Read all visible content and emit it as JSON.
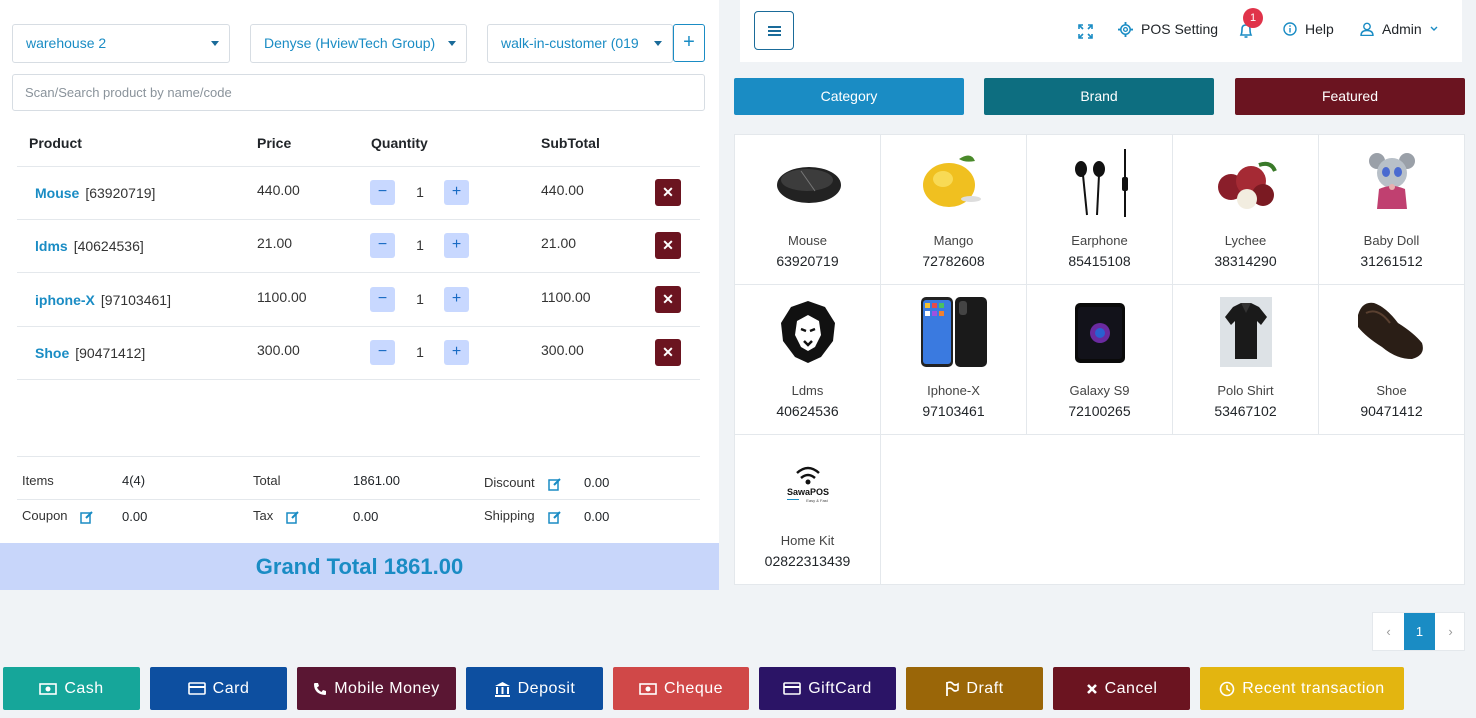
{
  "selectors": {
    "warehouse": "warehouse 2",
    "biller": "Denyse (HviewTech Group)",
    "customer": "walk-in-customer (019",
    "add_label": "+"
  },
  "search": {
    "placeholder": "Scan/Search product by name/code"
  },
  "cart": {
    "headers": {
      "product": "Product",
      "price": "Price",
      "quantity": "Quantity",
      "subtotal": "SubTotal"
    },
    "minus": "−",
    "plus": "+",
    "remove": "✕",
    "rows": [
      {
        "name": "Mouse",
        "code": "[63920719]",
        "price": "440.00",
        "qty": "1",
        "subtotal": "440.00"
      },
      {
        "name": "ldms",
        "code": "[40624536]",
        "price": "21.00",
        "qty": "1",
        "subtotal": "21.00"
      },
      {
        "name": "iphone-X",
        "code": "[97103461]",
        "price": "1100.00",
        "qty": "1",
        "subtotal": "1100.00"
      },
      {
        "name": "Shoe",
        "code": "[90471412]",
        "price": "300.00",
        "qty": "1",
        "subtotal": "300.00"
      }
    ]
  },
  "totals": {
    "items_label": "Items",
    "items_value": "4(4)",
    "total_label": "Total",
    "total_value": "1861.00",
    "discount_label": "Discount",
    "discount_value": "0.00",
    "coupon_label": "Coupon",
    "coupon_value": "0.00",
    "tax_label": "Tax",
    "tax_value": "0.00",
    "shipping_label": "Shipping",
    "shipping_value": "0.00",
    "grand_total": "Grand Total 1861.00"
  },
  "topbar": {
    "pos_setting": "POS Setting",
    "notification_count": "1",
    "help": "Help",
    "user": "Admin"
  },
  "tabs": {
    "category": "Category",
    "brand": "Brand",
    "featured": "Featured"
  },
  "products": [
    {
      "name": "Mouse",
      "code": "63920719",
      "icon": "mouse-image"
    },
    {
      "name": "Mango",
      "code": "72782608",
      "icon": "mango-image"
    },
    {
      "name": "Earphone",
      "code": "85415108",
      "icon": "earphone-image"
    },
    {
      "name": "Lychee",
      "code": "38314290",
      "icon": "lychee-image"
    },
    {
      "name": "Baby Doll",
      "code": "31261512",
      "icon": "baby-doll-image"
    },
    {
      "name": "Ldms",
      "code": "40624536",
      "icon": "lion-logo-image"
    },
    {
      "name": "Iphone-X",
      "code": "97103461",
      "icon": "iphone-image"
    },
    {
      "name": "Galaxy S9",
      "code": "72100265",
      "icon": "galaxy-image"
    },
    {
      "name": "Polo Shirt",
      "code": "53467102",
      "icon": "polo-shirt-image"
    },
    {
      "name": "Shoe",
      "code": "90471412",
      "icon": "shoe-image"
    },
    {
      "name": "Home Kit",
      "code": "02822313439",
      "icon": "sawapos-logo-image",
      "logo_text": "SawaPOS",
      "logo_tagline": "Easy & Fast"
    }
  ],
  "pagination": {
    "prev": "‹",
    "current": "1",
    "next": "›"
  },
  "actions": {
    "cash": "Cash",
    "card": "Card",
    "mobile_money": "Mobile Money",
    "deposit": "Deposit",
    "cheque": "Cheque",
    "giftcard": "GiftCard",
    "draft": "Draft",
    "cancel": "Cancel",
    "recent": "Recent transaction"
  },
  "colors": {
    "primary": "#1a8cc4",
    "brand_tab": "#0d6e80",
    "featured_tab": "#6b1420",
    "cash": "#16a69a",
    "card": "#0d4fa0",
    "mobile_money": "#5a1633",
    "deposit": "#0d4fa0",
    "cheque": "#d04848",
    "giftcard": "#2b1466",
    "draft": "#9a6608",
    "cancel": "#6b1420",
    "recent": "#e3b510"
  }
}
